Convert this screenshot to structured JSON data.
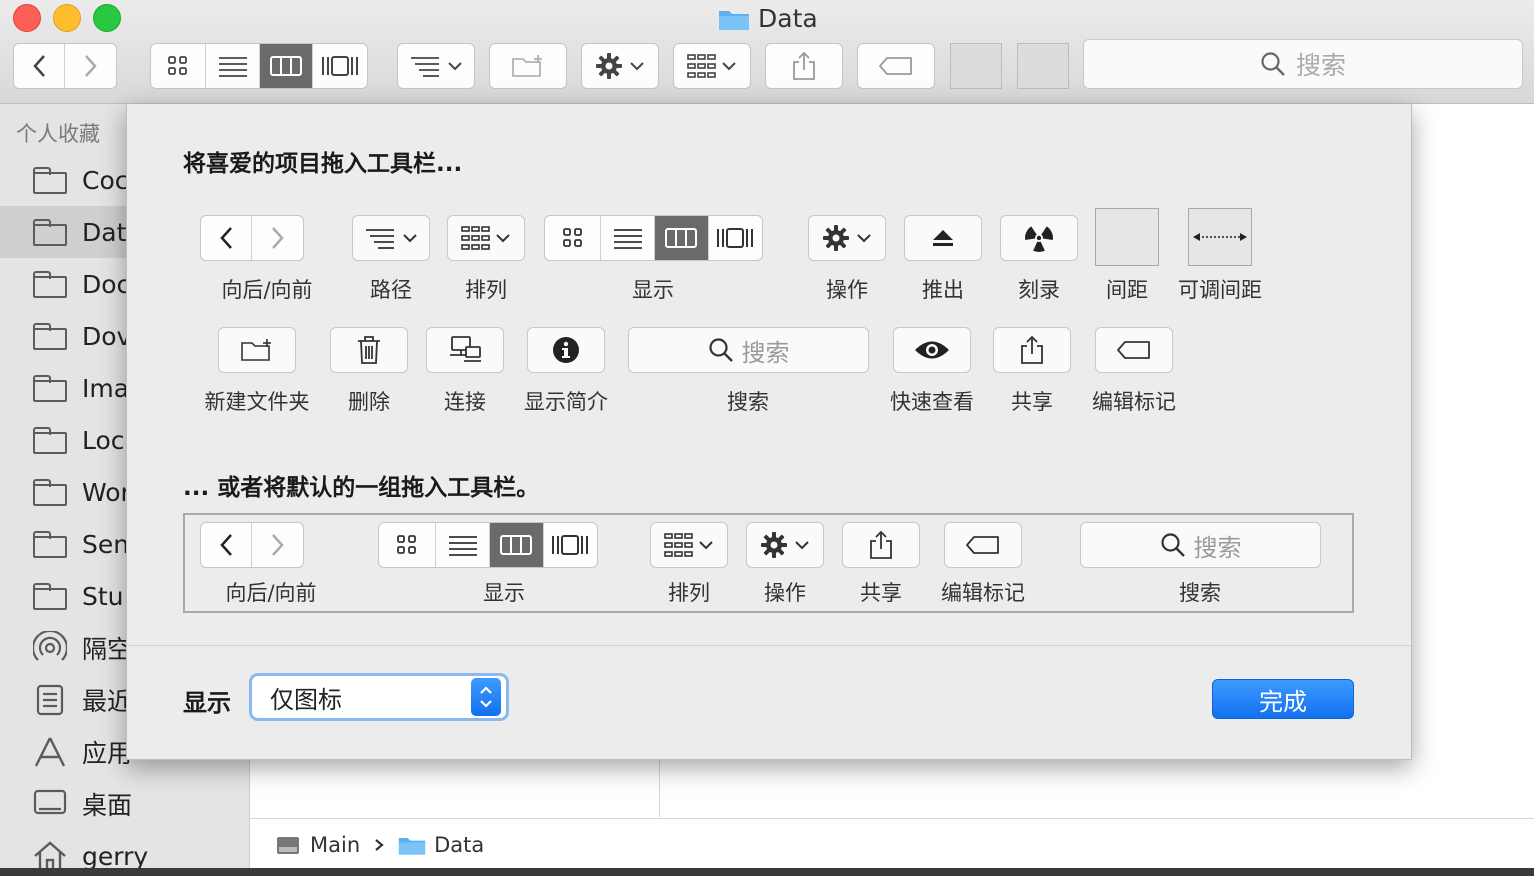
{
  "window": {
    "title": "Data",
    "search_placeholder": "搜索"
  },
  "sidebar": {
    "section_title": "个人收藏",
    "items": [
      {
        "label": "Coc"
      },
      {
        "label": "Dat"
      },
      {
        "label": "Doc"
      },
      {
        "label": "Dov"
      },
      {
        "label": "Ima"
      },
      {
        "label": "Loc"
      },
      {
        "label": "Wor"
      },
      {
        "label": "Sen"
      },
      {
        "label": "Stu"
      },
      {
        "label": "隔空"
      },
      {
        "label": "最近"
      },
      {
        "label": "应用"
      },
      {
        "label": "桌面"
      },
      {
        "label": "gerry"
      }
    ]
  },
  "pathbar": {
    "items": [
      {
        "label": "Main"
      },
      {
        "label": "Data"
      }
    ]
  },
  "sheet": {
    "heading_drag": "将喜爱的项目拖入工具栏...",
    "palette_labels": {
      "back_forward": "向后/向前",
      "path": "路径",
      "arrange": "排列",
      "view": "显示",
      "action": "操作",
      "eject": "推出",
      "burn": "刻录",
      "space": "间距",
      "flexible_space": "可调间距",
      "new_folder": "新建文件夹",
      "delete": "删除",
      "connect": "连接",
      "get_info": "显示简介",
      "search": "搜索",
      "quick_look": "快速查看",
      "share": "共享",
      "edit_tags": "编辑标记"
    },
    "search_placeholder": "搜索",
    "heading_default": "... 或者将默认的一组拖入工具栏。",
    "default_labels": {
      "back_forward": "向后/向前",
      "view": "显示",
      "arrange": "排列",
      "action": "操作",
      "share": "共享",
      "edit_tags": "编辑标记",
      "search": "搜索"
    },
    "show_label": "显示",
    "show_value": "仅图标",
    "done_label": "完成"
  }
}
